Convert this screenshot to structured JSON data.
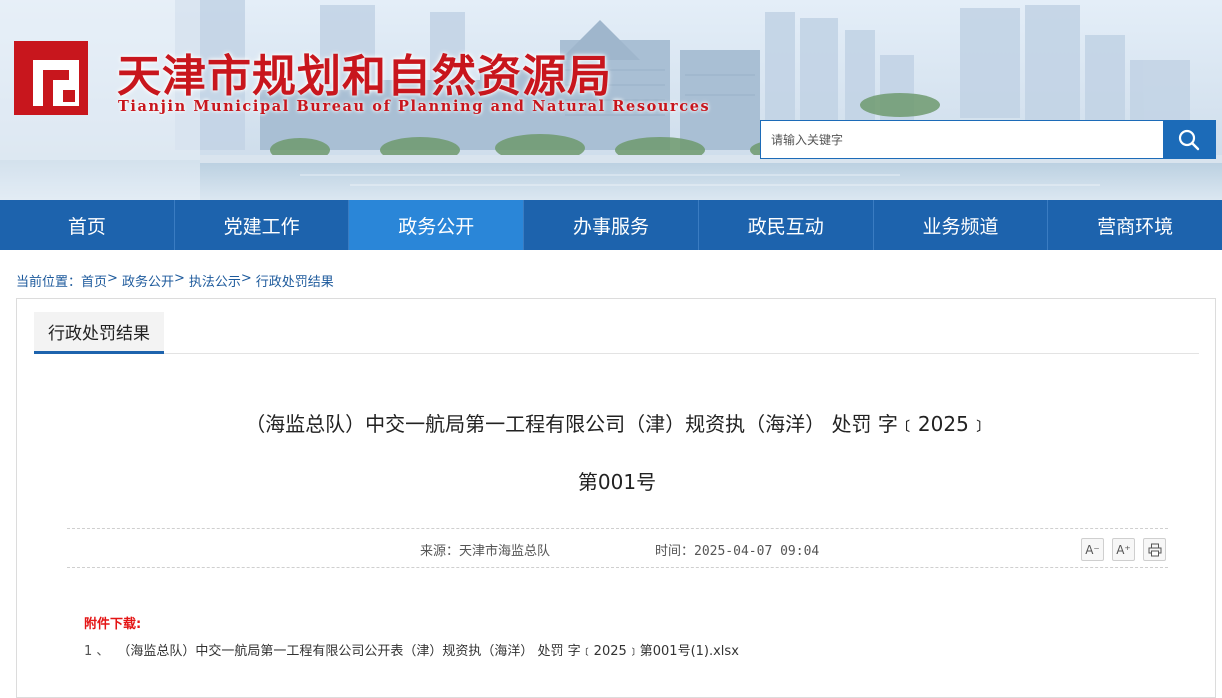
{
  "header": {
    "title_cn": "天津市规划和自然资源局",
    "title_en": "Tianjin Municipal Bureau of Planning and Natural Resources",
    "search_placeholder": "请输入关键字"
  },
  "nav": {
    "items": [
      {
        "label": "首页",
        "active": false
      },
      {
        "label": "党建工作",
        "active": false
      },
      {
        "label": "政务公开",
        "active": true
      },
      {
        "label": "办事服务",
        "active": false
      },
      {
        "label": "政民互动",
        "active": false
      },
      {
        "label": "业务频道",
        "active": false
      },
      {
        "label": "营商环境",
        "active": false
      }
    ]
  },
  "breadcrumb": {
    "prefix": "当前位置：",
    "items": [
      "首页",
      "政务公开",
      "执法公示",
      "行政处罚结果"
    ],
    "separator": ">"
  },
  "panel": {
    "tab_label": "行政处罚结果",
    "title_line1": "（海监总队）中交一航局第一工程有限公司（津）规资执（海洋） 处罚 字﹝2025﹞",
    "title_line2": "第001号",
    "source": "来源：天津市海监总队",
    "time": "时间：2025-04-07 09:04",
    "tools": {
      "font_decrease": "A⁻",
      "font_increase": "A⁺"
    },
    "attachments_label": "附件下载:",
    "attachments": [
      {
        "num": "1 、",
        "name": "（海监总队）中交一航局第一工程有限公司公开表（津）规资执（海洋） 处罚 字﹝2025﹞第001号(1).xlsx"
      }
    ]
  },
  "colors": {
    "brand_red": "#c8161d",
    "nav_blue": "#1d63ad",
    "nav_active": "#2a86d8",
    "attach_red": "#e41515"
  },
  "icons": [
    "logo-icon",
    "search-icon",
    "font-decrease-icon",
    "font-increase-icon",
    "print-icon"
  ]
}
